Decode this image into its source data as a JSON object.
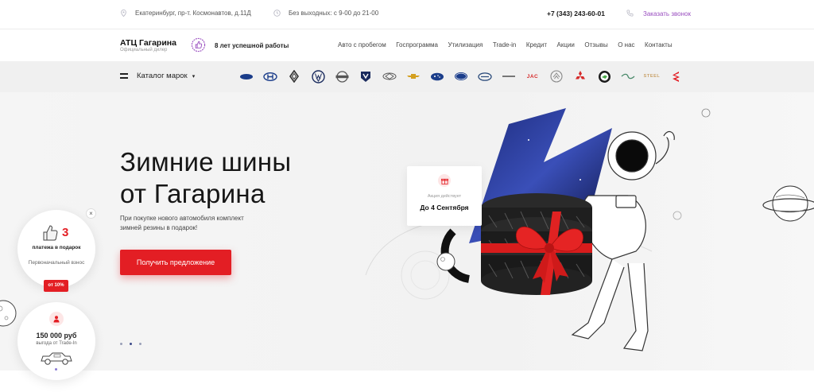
{
  "topbar": {
    "address": "Екатеринбург, пр-т. Космонавтов, д.11Д",
    "hours": "Без выходных: с 9-00 до 21-00",
    "phone": "+7 (343) 243-60-01",
    "callback": "Заказать звонок"
  },
  "header": {
    "logo_title": "АТЦ Гагарина",
    "logo_sub": "Официальный дилер",
    "years": "8 лет успешной работы",
    "nav": [
      "Авто с пробегом",
      "Госпрограмма",
      "Утилизация",
      "Trade-in",
      "Кредит",
      "Акции",
      "Отзывы",
      "О нас",
      "Контакты"
    ]
  },
  "brands_bar": {
    "catalog_label": "Каталог марок",
    "brand_icons": [
      "hyundai-like-icon",
      "hyundai-icon",
      "renault-icon",
      "volkswagen-icon",
      "nissan-icon",
      "changan-icon",
      "chery-icon",
      "chevrolet-icon",
      "subaru-icon",
      "ford-icon",
      "geely-icon",
      "haval-icon",
      "jac-icon",
      "lifan-icon",
      "mitsubishi-icon",
      "skoda-icon",
      "great-wall-icon",
      "steel-icon",
      "suzuki-icon"
    ],
    "jac_text": "JAC",
    "steel_text": "STEEL"
  },
  "hero": {
    "title_line1": "Зимние шины",
    "title_line2": "от Гагарина",
    "subtitle": "При покупке нового автомобиля комплект зимней резины в подарок!",
    "cta": "Получить предложение",
    "promo_small": "Акция действует",
    "promo_date": "До 4 Сентября"
  },
  "widgets": {
    "w1_number": "3",
    "w1_line1": "платежа в подарок",
    "w1_line2": "Первоначальный взнос",
    "w1_badge": "от 10%",
    "w1_close": "×",
    "w2_amount": "150 000 руб",
    "w2_sub": "выгода от Trade-In"
  },
  "colors": {
    "accent": "#e31e24",
    "purple": "#9a4fc0"
  }
}
